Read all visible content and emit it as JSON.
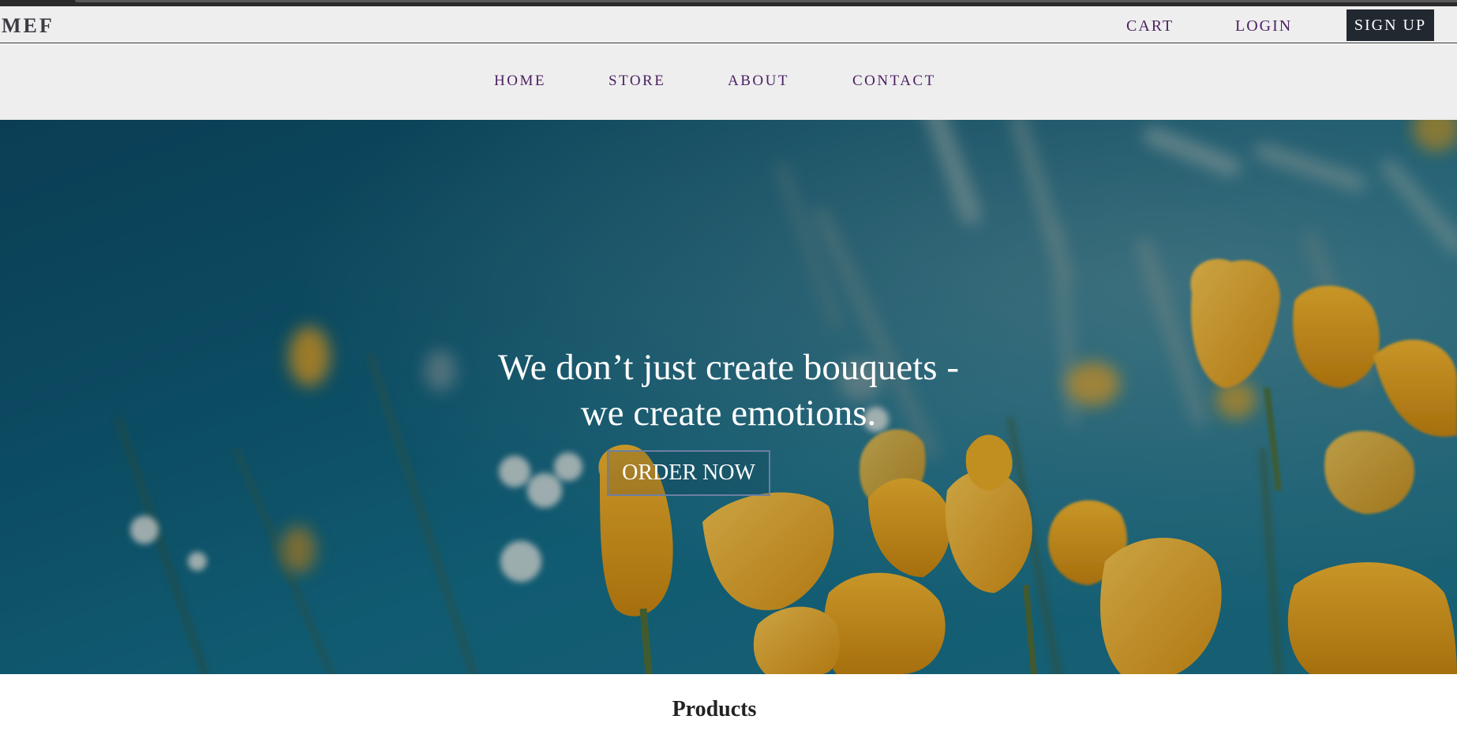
{
  "brand": {
    "logo": "MEF"
  },
  "topbar": {
    "links": [
      {
        "label": "CART"
      },
      {
        "label": "LOGIN"
      }
    ],
    "signup_label": "SIGN UP"
  },
  "nav": {
    "items": [
      {
        "label": "HOME"
      },
      {
        "label": "STORE"
      },
      {
        "label": "ABOUT"
      },
      {
        "label": "CONTACT"
      }
    ]
  },
  "hero": {
    "headline_line1": "We don’t just create bouquets -",
    "headline_line2": "we create emotions.",
    "cta_label": "ORDER NOW",
    "image": "flowers-photo"
  },
  "products": {
    "heading": "Products"
  },
  "colors": {
    "nav_text": "#4b1f62",
    "bar_bg": "#eeeeee",
    "signup_bg": "#222830",
    "hero_base": "#0d5872",
    "flower": "#e8a20e"
  }
}
